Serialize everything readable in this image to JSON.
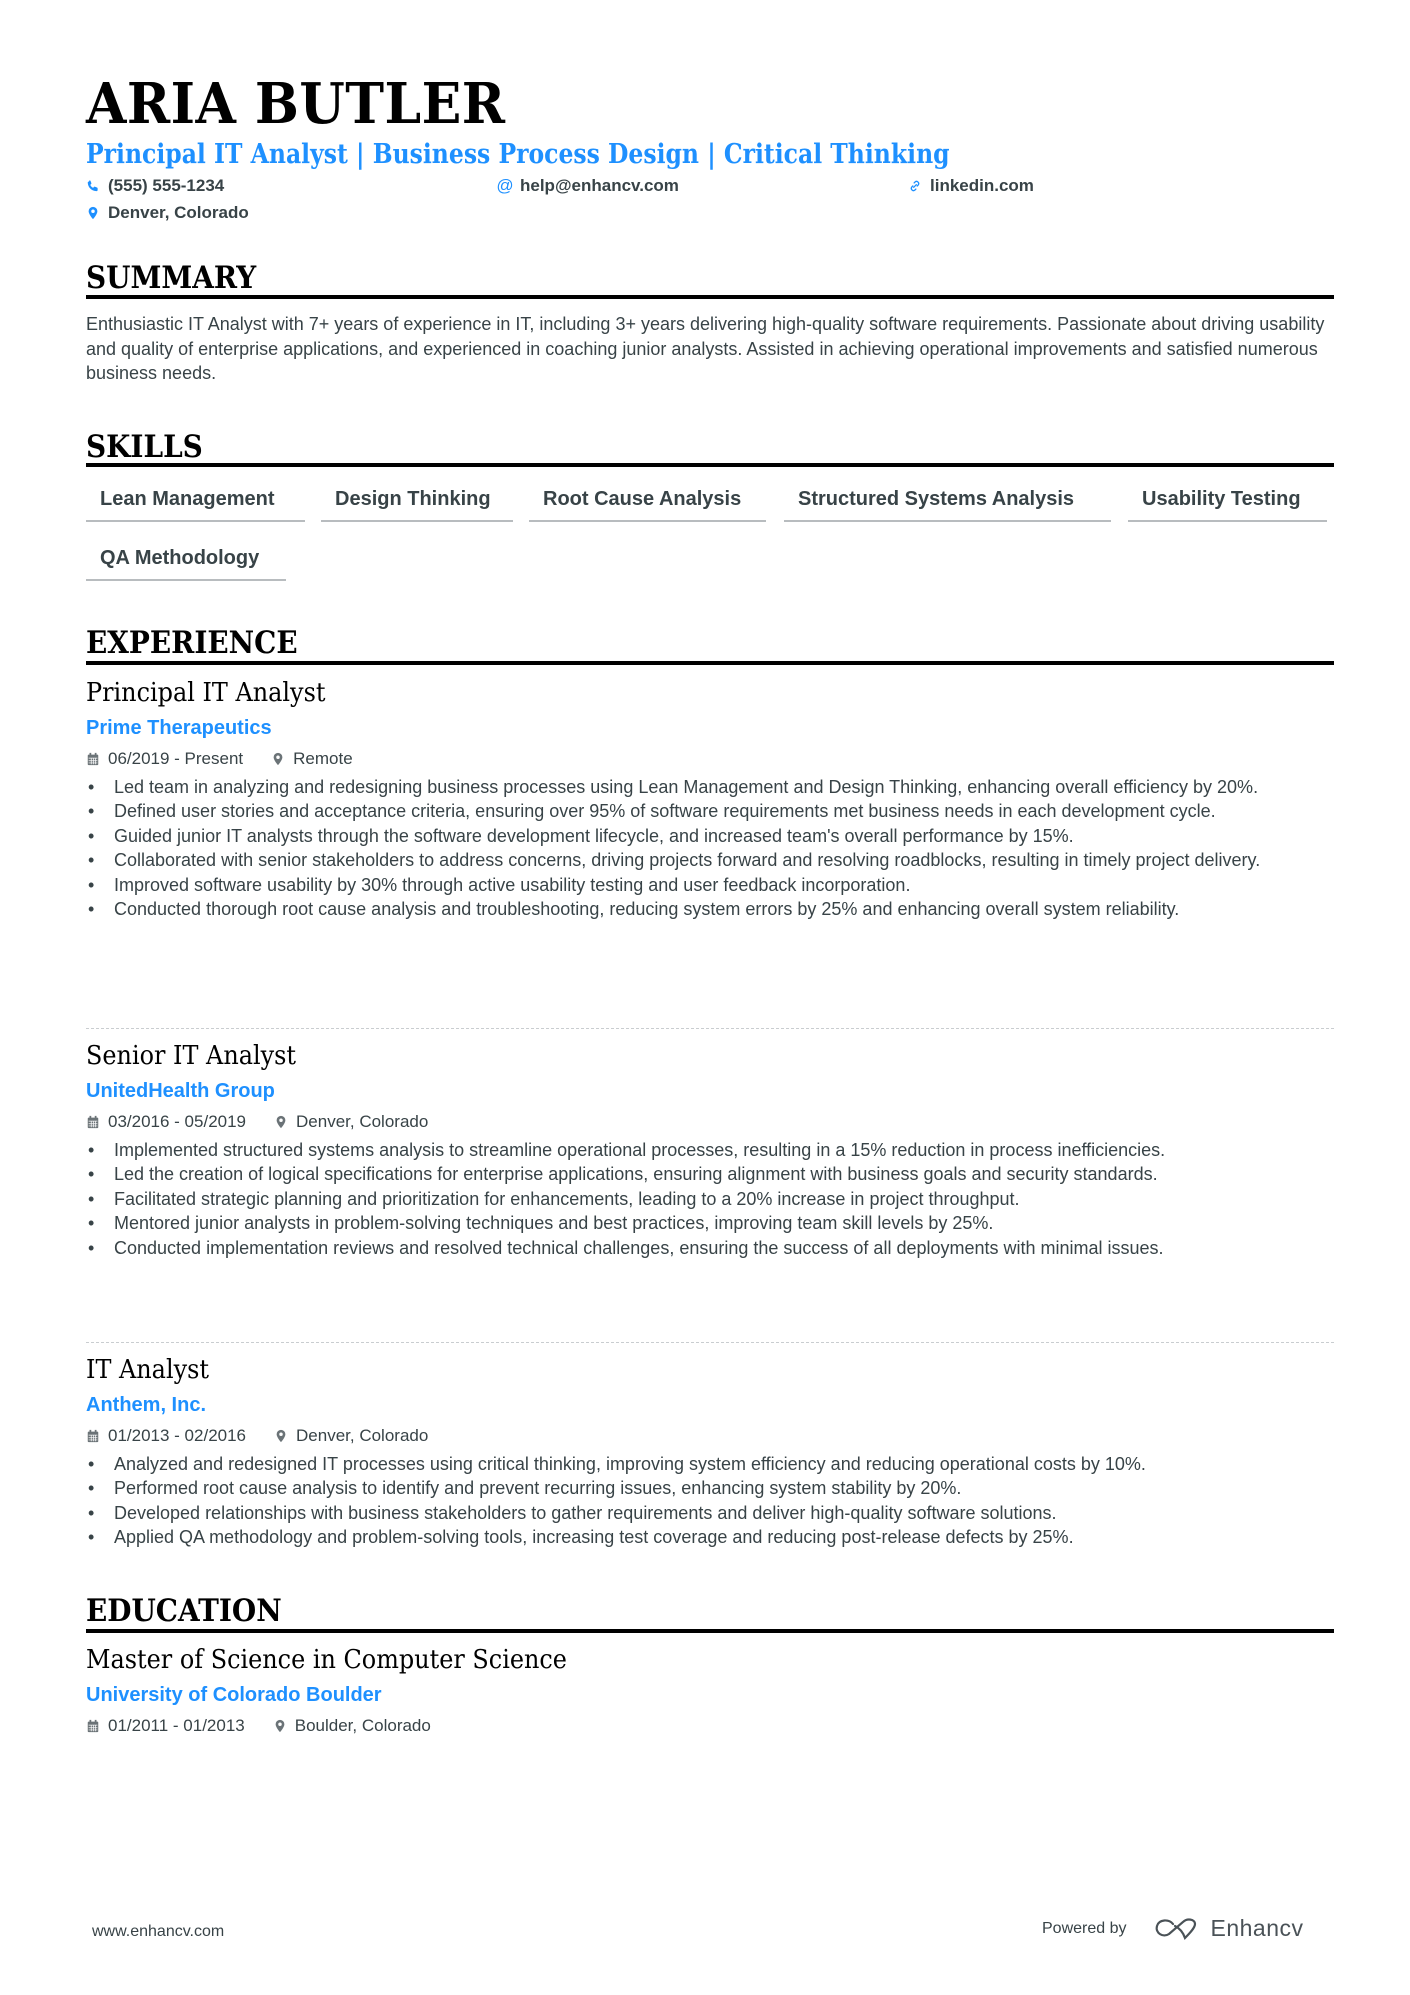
{
  "header": {
    "name": "ARIA BUTLER",
    "subtitle": "Principal IT Analyst | Business Process Design | Critical Thinking",
    "contacts": {
      "phone": {
        "icon": "phone-icon",
        "text": "(555) 555-1234"
      },
      "email": {
        "icon": "at-icon",
        "text": "help@enhancv.com"
      },
      "linkedin": {
        "icon": "link-icon",
        "text": "linkedin.com"
      },
      "location": {
        "icon": "location-pin-icon",
        "text": "Denver, Colorado"
      }
    }
  },
  "summary": {
    "title": "SUMMARY",
    "text": "Enthusiastic IT Analyst with 7+ years of experience in IT, including 3+ years delivering high-quality software requirements. Passionate about driving usability and quality of enterprise applications, and experienced in coaching junior analysts. Assisted in achieving operational improvements and satisfied numerous business needs."
  },
  "skills": {
    "title": "SKILLS",
    "items": [
      "Lean Management",
      "Design Thinking",
      "Root Cause Analysis",
      "Structured Systems Analysis",
      "Usability Testing",
      "QA Methodology"
    ]
  },
  "experience": {
    "title": "EXPERIENCE",
    "jobs": [
      {
        "title": "Principal IT Analyst",
        "company": "Prime Therapeutics",
        "dates": "06/2019 - Present",
        "location": "Remote",
        "bullets": [
          "Led team in analyzing and redesigning business processes using Lean Management and Design Thinking, enhancing overall efficiency by 20%.",
          "Defined user stories and acceptance criteria, ensuring over 95% of software requirements met business needs in each development cycle.",
          "Guided junior IT analysts through the software development lifecycle, and increased team's overall performance by 15%.",
          "Collaborated with senior stakeholders to address concerns, driving projects forward and resolving roadblocks, resulting in timely project delivery.",
          "Improved software usability by 30% through active usability testing and user feedback incorporation.",
          "Conducted thorough root cause analysis and troubleshooting, reducing system errors by 25% and enhancing overall system reliability."
        ]
      },
      {
        "title": "Senior IT Analyst",
        "company": "UnitedHealth Group",
        "dates": "03/2016 - 05/2019",
        "location": "Denver, Colorado",
        "bullets": [
          "Implemented structured systems analysis to streamline operational processes, resulting in a 15% reduction in process inefficiencies.",
          "Led the creation of logical specifications for enterprise applications, ensuring alignment with business goals and security standards.",
          "Facilitated strategic planning and prioritization for enhancements, leading to a 20% increase in project throughput.",
          "Mentored junior analysts in problem-solving techniques and best practices, improving team skill levels by 25%.",
          "Conducted implementation reviews and resolved technical challenges, ensuring the success of all deployments with minimal issues."
        ]
      },
      {
        "title": "IT Analyst",
        "company": "Anthem, Inc.",
        "dates": "01/2013 - 02/2016",
        "location": "Denver, Colorado",
        "bullets": [
          "Analyzed and redesigned IT processes using critical thinking, improving system efficiency and reducing operational costs by 10%.",
          "Performed root cause analysis to identify and prevent recurring issues, enhancing system stability by 20%.",
          "Developed relationships with business stakeholders to gather requirements and deliver high-quality software solutions.",
          "Applied QA methodology and problem-solving tools, increasing test coverage and reducing post-release defects by 25%."
        ]
      }
    ]
  },
  "education": {
    "title": "EDUCATION",
    "degree": "Master of Science in Computer Science",
    "school": "University of Colorado Boulder",
    "dates": "01/2011 - 01/2013",
    "location": "Boulder, Colorado"
  },
  "footer": {
    "website": "www.enhancv.com",
    "powered_by": "Powered by",
    "brand": "Enhancv"
  },
  "colors": {
    "accent": "#1e90ff",
    "text": "#384347",
    "heading": "#000000"
  }
}
